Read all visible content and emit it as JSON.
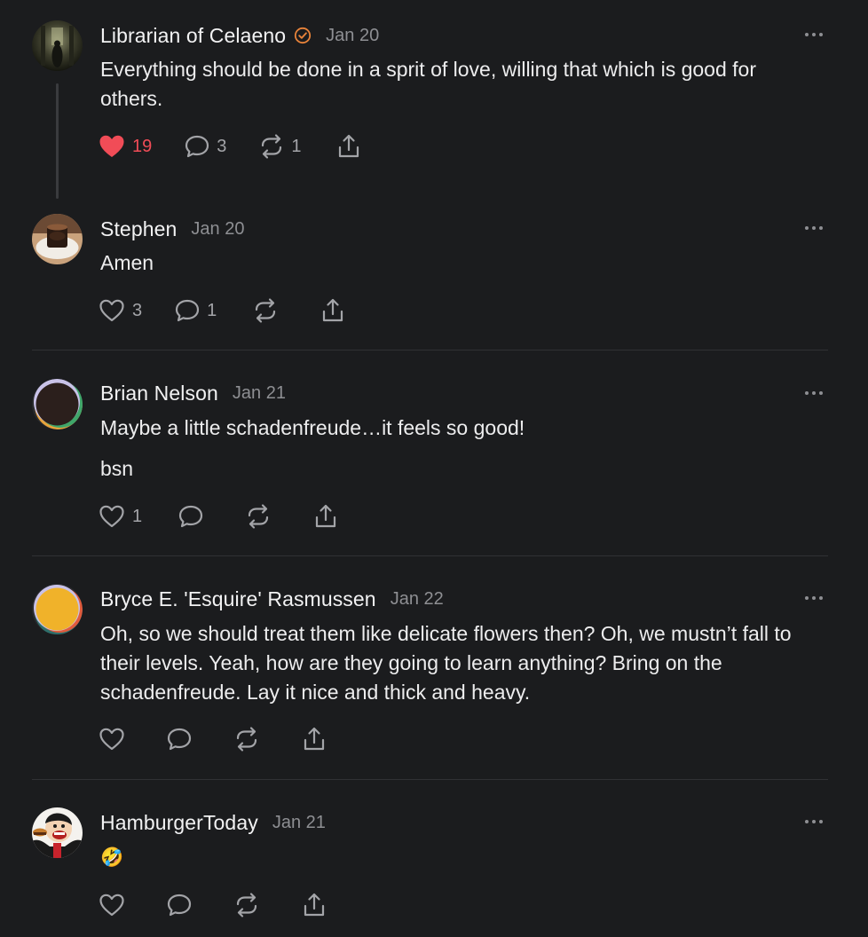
{
  "colors": {
    "background": "#1b1c1e",
    "text": "#ededee",
    "muted": "#8e8f93",
    "like_active": "#f14c57",
    "verified": "#e8833a"
  },
  "posts": [
    {
      "author": "Librarian of Celaeno",
      "verified": true,
      "date": "Jan 20",
      "text": "Everything should be done in a sprit of love, willing that which is good for others.",
      "text_extra": "",
      "likes": "19",
      "liked": true,
      "replies": "3",
      "restacks": "1"
    },
    {
      "author": "Stephen",
      "date": "Jan 20",
      "text": "Amen",
      "likes": "3",
      "replies": "1",
      "restacks": ""
    },
    {
      "author": "Brian Nelson",
      "date": "Jan 21",
      "text": "Maybe a little schadenfreude…it feels so good!",
      "text_extra": "bsn",
      "likes": "1",
      "replies": "",
      "restacks": ""
    },
    {
      "author": "Bryce E. 'Esquire' Rasmussen",
      "date": "Jan 22",
      "text": "Oh, so we should treat them like delicate flowers then? Oh, we mustn’t fall to their levels. Yeah, how are they going to learn anything? Bring on the schadenfreude. Lay it nice and thick and heavy.",
      "likes": "",
      "replies": "",
      "restacks": ""
    },
    {
      "author": "HamburgerToday",
      "date": "Jan 21",
      "text": "🤣",
      "likes": "",
      "replies": "",
      "restacks": ""
    }
  ],
  "icons": {
    "like": "heart-icon",
    "reply": "speech-bubble-icon",
    "restack": "restack-arrows-icon",
    "share": "share-upload-icon",
    "more": "more-dots-icon",
    "verified": "verified-check-icon"
  }
}
